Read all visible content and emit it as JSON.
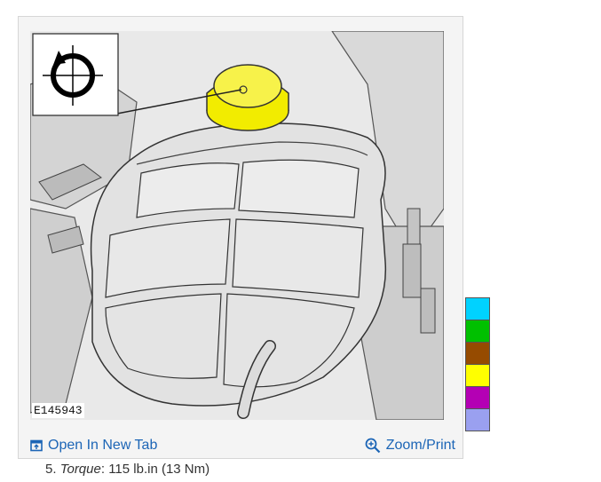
{
  "figure": {
    "id_label": "E145943",
    "open_link_label": "Open In New Tab",
    "zoom_link_label": "Zoom/Print",
    "link_color": "#1c65b6",
    "highlight_color": "#f2ec00"
  },
  "swatches": [
    {
      "color": "#00d2ff"
    },
    {
      "color": "#00c000"
    },
    {
      "color": "#964b00"
    },
    {
      "color": "#ffff00"
    },
    {
      "color": "#b400b4"
    },
    {
      "color": "#9aa0f0"
    }
  ],
  "step": {
    "number": "5.",
    "label": "Torque",
    "separator": ":",
    "value": "115 lb.in (13 Nm)"
  }
}
